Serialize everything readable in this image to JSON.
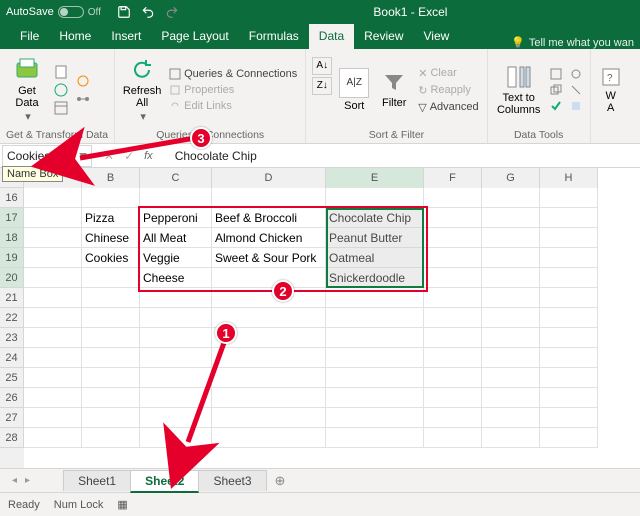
{
  "titlebar": {
    "autosave_label": "AutoSave",
    "autosave_state": "Off",
    "doc_title": "Book1 - Excel"
  },
  "tabs": {
    "file": "File",
    "home": "Home",
    "insert": "Insert",
    "page_layout": "Page Layout",
    "formulas": "Formulas",
    "data": "Data",
    "review": "Review",
    "view": "View",
    "tellme": "Tell me what you wan"
  },
  "ribbon": {
    "g1": {
      "get_data": "Get\nData",
      "label": "Get & Transform Data"
    },
    "g2": {
      "refresh": "Refresh\nAll",
      "qc": "Queries & Connections",
      "props": "Properties",
      "links": "Edit Links",
      "label": "Queries & Connections"
    },
    "g3": {
      "sort": "Sort",
      "filter": "Filter",
      "clear": "Clear",
      "reapply": "Reapply",
      "advanced": "Advanced",
      "label": "Sort & Filter"
    },
    "g4": {
      "ttc": "Text to\nColumns",
      "label": "Data Tools"
    },
    "g5": {
      "wa": "W\nA"
    }
  },
  "namebox": {
    "value": "Cookies",
    "tooltip": "Name Box"
  },
  "formula": {
    "value": "Chocolate Chip"
  },
  "columns": [
    "A",
    "B",
    "C",
    "D",
    "E",
    "F",
    "G",
    "H"
  ],
  "rows": [
    "16",
    "17",
    "18",
    "19",
    "20",
    "21",
    "22",
    "23",
    "24",
    "25",
    "26",
    "27",
    "28"
  ],
  "cells": {
    "B17": "Pizza",
    "C17": "Pepperoni",
    "D17": "Beef & Broccoli",
    "E17": "Chocolate Chip",
    "B18": "Chinese",
    "C18": "All Meat",
    "D18": "Almond Chicken",
    "E18": "Peanut Butter",
    "B19": "Cookies",
    "C19": "Veggie",
    "D19": "Sweet & Sour Pork",
    "E19": "Oatmeal",
    "C20": "Cheese",
    "E20": "Snickerdoodle"
  },
  "callouts": {
    "c1": "1",
    "c2": "2",
    "c3": "3"
  },
  "sheets": {
    "s1": "Sheet1",
    "s2": "Sheet2",
    "s3": "Sheet3"
  },
  "status": {
    "ready": "Ready",
    "numlock": "Num Lock"
  }
}
